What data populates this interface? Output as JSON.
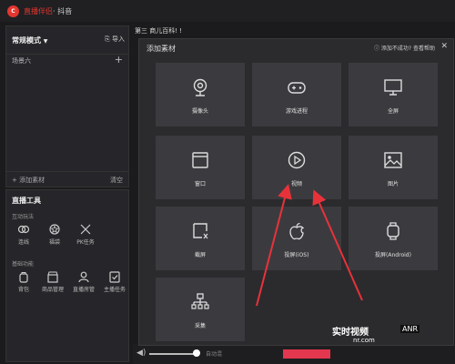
{
  "app": {
    "title": "直播伴侣",
    "subtitle": "· 抖音"
  },
  "left_panel": {
    "mode_label": "常规模式",
    "import_label": "导入",
    "scene_name": "场景六",
    "add_material": "添加素材",
    "clear": "清空"
  },
  "tools": {
    "title": "直播工具",
    "group1": "互动玩法",
    "group1_items": [
      "连线",
      "福袋",
      "PK任务"
    ],
    "group2": "基础功能",
    "group2_items": [
      "背包",
      "商品管理",
      "直播房管",
      "主播任务"
    ]
  },
  "preview": {
    "text": "第三 商儿百科! !"
  },
  "bottom": {
    "auto_label": "自动混"
  },
  "modal": {
    "title": "添加素材",
    "help": "添加不成功? 查看帮助",
    "tiles": [
      "摄像头",
      "游戏进程",
      "全屏",
      "窗口",
      "视频",
      "图片",
      "截屏",
      "投屏(iOS)",
      "投屏(Android)",
      "采集"
    ]
  },
  "watermark": {
    "line1": "实时视频",
    "line2": "nr.com",
    "badge": "ANR"
  },
  "colors": {
    "accent": "#e3372f",
    "arrow": "#e8323a"
  }
}
